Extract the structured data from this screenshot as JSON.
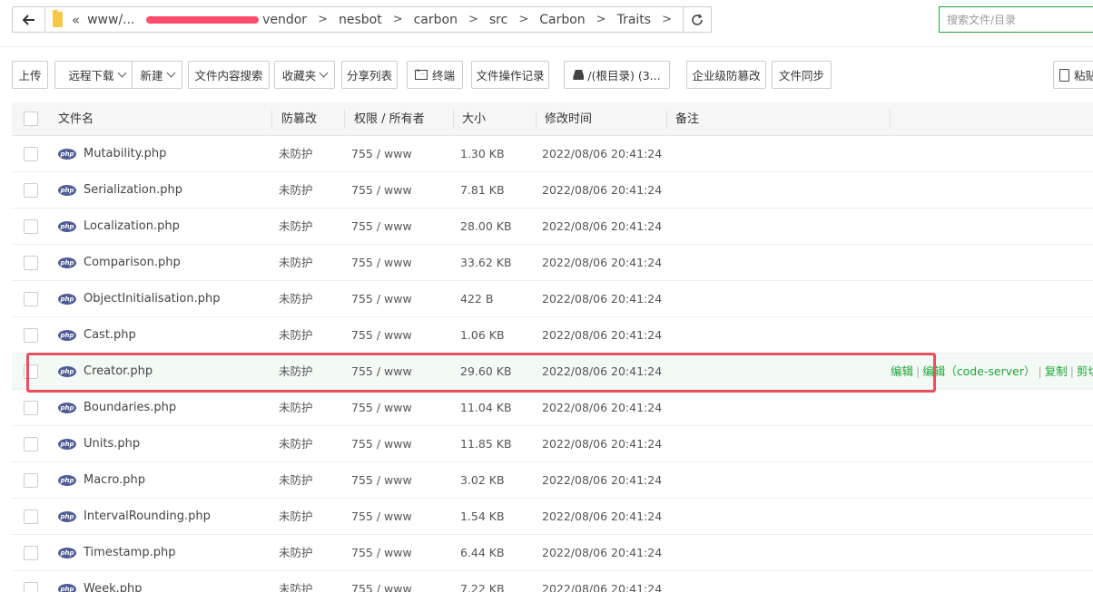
{
  "address": {
    "crumbs_visible_start": "www/...",
    "crumbs": [
      "vendor",
      "nesbot",
      "carbon",
      "src",
      "Carbon",
      "Traits"
    ],
    "search_placeholder": "搜索文件/目录"
  },
  "toolbar": {
    "upload": "上传",
    "remote_download": "远程下载",
    "new": "新建",
    "content_search": "文件内容搜索",
    "favorites": "收藏夹",
    "share_list": "分享列表",
    "terminal": "终端",
    "operation_log": "文件操作记录",
    "disk": "/(根目录) (3...",
    "enterprise_tamper": "企业级防篡改",
    "file_sync": "文件同步",
    "paste": "粘贴"
  },
  "table": {
    "headers": {
      "name": "文件名",
      "tamper": "防篡改",
      "perm": "权限 / 所有者",
      "size": "大小",
      "mtime": "修改时间",
      "note": "备注"
    },
    "rows": [
      {
        "name": "Mutability.php",
        "tamper": "未防护",
        "perm": "755 / www",
        "size": "1.30 KB",
        "mtime": "2022/08/06 20:41:24"
      },
      {
        "name": "Serialization.php",
        "tamper": "未防护",
        "perm": "755 / www",
        "size": "7.81 KB",
        "mtime": "2022/08/06 20:41:24"
      },
      {
        "name": "Localization.php",
        "tamper": "未防护",
        "perm": "755 / www",
        "size": "28.00 KB",
        "mtime": "2022/08/06 20:41:24"
      },
      {
        "name": "Comparison.php",
        "tamper": "未防护",
        "perm": "755 / www",
        "size": "33.62 KB",
        "mtime": "2022/08/06 20:41:24"
      },
      {
        "name": "ObjectInitialisation.php",
        "tamper": "未防护",
        "perm": "755 / www",
        "size": "422 B",
        "mtime": "2022/08/06 20:41:24"
      },
      {
        "name": "Cast.php",
        "tamper": "未防护",
        "perm": "755 / www",
        "size": "1.06 KB",
        "mtime": "2022/08/06 20:41:24"
      },
      {
        "name": "Creator.php",
        "tamper": "未防护",
        "perm": "755 / www",
        "size": "29.60 KB",
        "mtime": "2022/08/06 20:41:24"
      },
      {
        "name": "Boundaries.php",
        "tamper": "未防护",
        "perm": "755 / www",
        "size": "11.04 KB",
        "mtime": "2022/08/06 20:41:24"
      },
      {
        "name": "Units.php",
        "tamper": "未防护",
        "perm": "755 / www",
        "size": "11.85 KB",
        "mtime": "2022/08/06 20:41:24"
      },
      {
        "name": "Macro.php",
        "tamper": "未防护",
        "perm": "755 / www",
        "size": "3.02 KB",
        "mtime": "2022/08/06 20:41:24"
      },
      {
        "name": "IntervalRounding.php",
        "tamper": "未防护",
        "perm": "755 / www",
        "size": "1.54 KB",
        "mtime": "2022/08/06 20:41:24"
      },
      {
        "name": "Timestamp.php",
        "tamper": "未防护",
        "perm": "755 / www",
        "size": "6.44 KB",
        "mtime": "2022/08/06 20:41:24"
      },
      {
        "name": "Week.php",
        "tamper": "未防护",
        "perm": "755 / www",
        "size": "7.22 KB",
        "mtime": "2022/08/06 20:41:24"
      }
    ],
    "hover_row_ops": [
      "编辑",
      "编辑（code-server）",
      "复制",
      "剪切"
    ],
    "file_type_badge": "php"
  },
  "colors": {
    "accent": "#20a53a",
    "highlight": "#e8505e",
    "php_badge": "#4f5b93"
  }
}
